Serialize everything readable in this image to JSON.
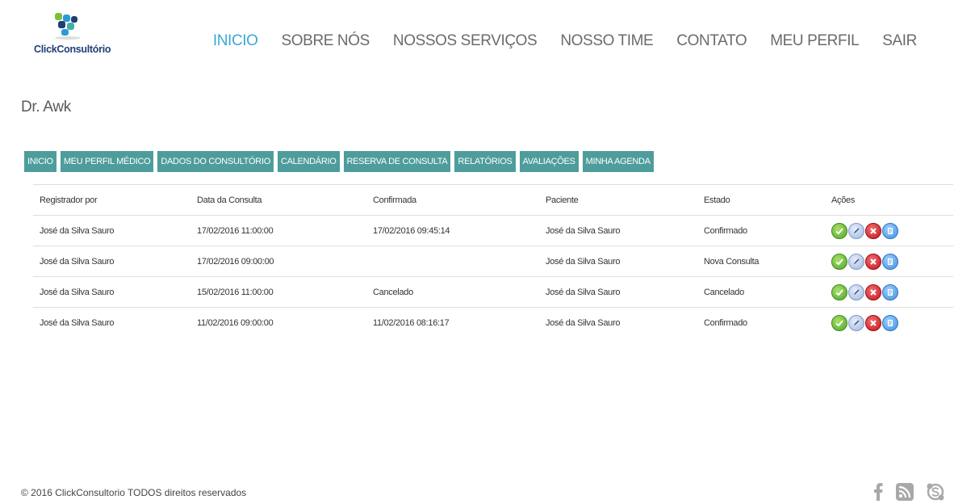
{
  "logo": {
    "text": "ClickConsultório"
  },
  "nav": {
    "items": [
      {
        "label": "INICIO",
        "active": true
      },
      {
        "label": "SOBRE NÓS"
      },
      {
        "label": "NOSSOS SERVIÇOS"
      },
      {
        "label": "NOSSO TIME"
      },
      {
        "label": "CONTATO"
      },
      {
        "label": "MEU PERFIL"
      },
      {
        "label": "SAIR"
      }
    ]
  },
  "page": {
    "title": "Dr. Awk"
  },
  "subnav": {
    "items": [
      {
        "label": "INICIO"
      },
      {
        "label": "MEU PERFIL MÉDICO"
      },
      {
        "label": "DADOS DO CONSULTÓRIO"
      },
      {
        "label": "CALENDÁRIO"
      },
      {
        "label": "RESERVA DE CONSULTA"
      },
      {
        "label": "RELATÓRIOS"
      },
      {
        "label": "AVALIAÇÕES"
      },
      {
        "label": "MINHA AGENDA"
      }
    ]
  },
  "table": {
    "headers": [
      "Registrador por",
      "Data da Consulta",
      "Confirmada",
      "Paciente",
      "Estado",
      "Ações"
    ],
    "rows": [
      {
        "registrador": "José da Silva Sauro",
        "data": "17/02/2016 11:00:00",
        "confirmada": "17/02/2016 09:45:14",
        "paciente": "José da Silva Sauro",
        "estado": "Confirmado"
      },
      {
        "registrador": "José da Silva Sauro",
        "data": "17/02/2016 09:00:00",
        "confirmada": "",
        "paciente": "José da Silva Sauro",
        "estado": "Nova Consulta"
      },
      {
        "registrador": "José da Silva Sauro",
        "data": "15/02/2016 11:00:00",
        "confirmada": "Cancelado",
        "paciente": "José da Silva Sauro",
        "estado": "Cancelado"
      },
      {
        "registrador": "José da Silva Sauro",
        "data": "11/02/2016 09:00:00",
        "confirmada": "11/02/2016 08:16:17",
        "paciente": "José da Silva Sauro",
        "estado": "Confirmado"
      }
    ],
    "action_icons": [
      "check-icon",
      "edit-icon",
      "delete-icon",
      "document-icon"
    ]
  },
  "footer": {
    "copyright": "© 2016 ClickConsultorio TODOS direitos reservados",
    "social_icons": [
      "facebook-icon",
      "rss-icon",
      "skype-icon"
    ]
  },
  "colors": {
    "nav_active": "#3aa8d6",
    "nav_text": "#6b6b6b",
    "subnav_bg": "#4f9c9c",
    "logo_text": "#1e3f74"
  }
}
